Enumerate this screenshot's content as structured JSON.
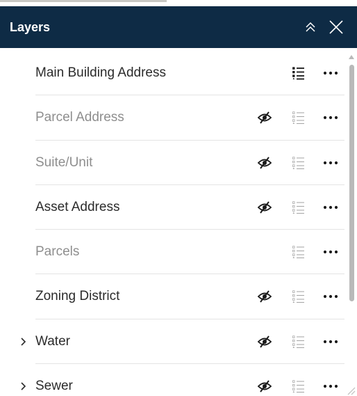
{
  "panel": {
    "title": "Layers",
    "collapse_icon": "double-chevron-up-icon",
    "close_icon": "close-icon"
  },
  "colors": {
    "header_bg": "#0e2b45",
    "visible_text": "#2b2b2b",
    "hidden_text": "#8e8e8e",
    "icon_active": "#1a1a1a",
    "icon_muted": "#a8a8a8"
  },
  "layers": [
    {
      "label": "Main Building Address",
      "visible": true,
      "expandable": false,
      "show_visibility_icon": false
    },
    {
      "label": "Parcel Address",
      "visible": false,
      "expandable": false,
      "show_visibility_icon": true
    },
    {
      "label": "Suite/Unit",
      "visible": false,
      "expandable": false,
      "show_visibility_icon": true
    },
    {
      "label": "Asset Address",
      "visible": true,
      "expandable": false,
      "show_visibility_icon": true
    },
    {
      "label": "Parcels",
      "visible": false,
      "expandable": false,
      "show_visibility_icon": false
    },
    {
      "label": "Zoning District",
      "visible": true,
      "expandable": false,
      "show_visibility_icon": true
    },
    {
      "label": "Water",
      "visible": true,
      "expandable": true,
      "show_visibility_icon": true
    },
    {
      "label": "Sewer",
      "visible": true,
      "expandable": true,
      "show_visibility_icon": true
    }
  ],
  "row_icons": {
    "expand": "chevron-right-icon",
    "visibility": "eye-off-icon",
    "legend": "legend-list-icon",
    "options": "more-options-icon"
  }
}
